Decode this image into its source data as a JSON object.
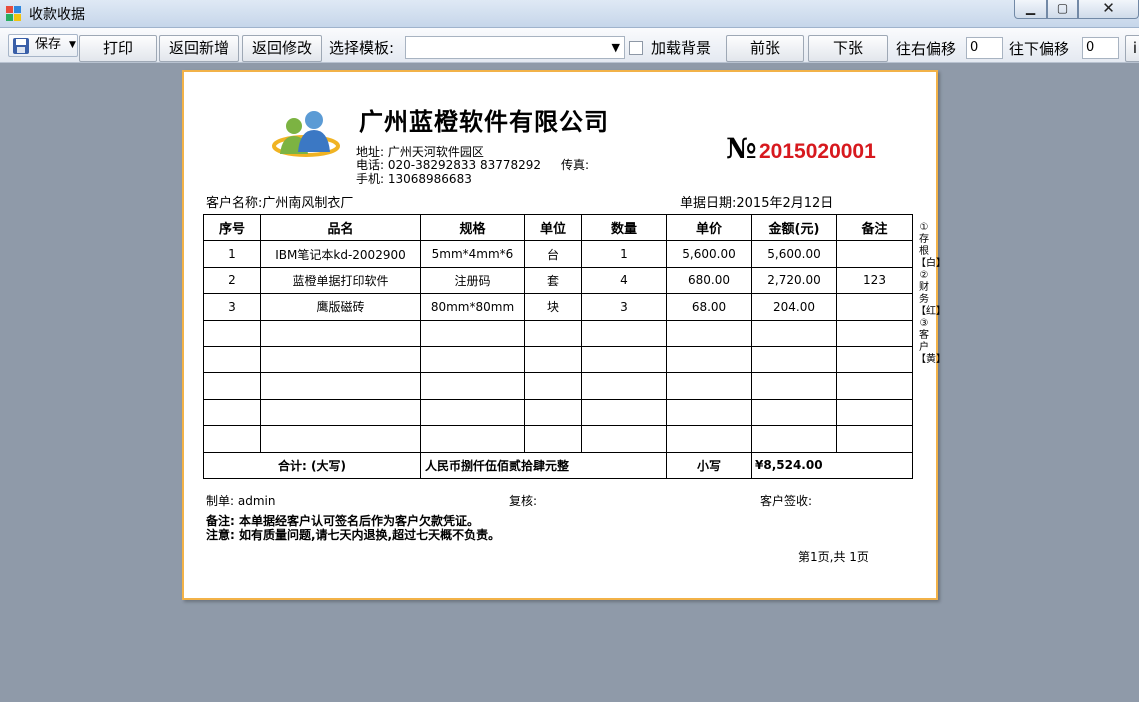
{
  "window": {
    "title": "收款收据"
  },
  "toolbar": {
    "save_label": "保存",
    "print_label": "打印",
    "back_new_label": "返回新增",
    "back_edit_label": "返回修改",
    "template_label": "选择模板:",
    "template_value": "",
    "load_bg_label": "加载背景",
    "prev_label": "前张",
    "next_label": "下张",
    "offset_right_label": "往右偏移",
    "offset_right_value": "0",
    "offset_down_label": "往下偏移",
    "offset_down_value": "0",
    "cut_label": "i"
  },
  "receipt": {
    "company": "广州蓝橙软件有限公司",
    "address": "地址: 广州天河软件园区",
    "phone": "电话: 020-38292833 83778292",
    "fax": "传真:",
    "mobile": "手机: 13068986683",
    "no_mark": "№",
    "number": "2015020001",
    "customer": "客户名称:广州南风制衣厂",
    "date": "单据日期:2015年2月12日",
    "headers": [
      "序号",
      "品名",
      "规格",
      "单位",
      "数量",
      "单价",
      "金额(元)",
      "备注"
    ],
    "rows": [
      [
        "1",
        "IBM笔记本kd-2002900",
        "5mm*4mm*6",
        "台",
        "1",
        "5,600.00",
        "5,600.00",
        ""
      ],
      [
        "2",
        "蓝橙单据打印软件",
        "注册码",
        "套",
        "4",
        "680.00",
        "2,720.00",
        "123"
      ],
      [
        "3",
        "鹰版磁砖",
        "80mm*80mm",
        "块",
        "3",
        "68.00",
        "204.00",
        ""
      ],
      [
        "",
        "",
        "",
        "",
        "",
        "",
        "",
        ""
      ],
      [
        "",
        "",
        "",
        "",
        "",
        "",
        "",
        ""
      ],
      [
        "",
        "",
        "",
        "",
        "",
        "",
        "",
        ""
      ],
      [
        "",
        "",
        "",
        "",
        "",
        "",
        "",
        ""
      ],
      [
        "",
        "",
        "",
        "",
        "",
        "",
        "",
        ""
      ]
    ],
    "total_label": "合计: (大写)",
    "total_upper": "人民币捌仟伍佰贰拾肆元整",
    "small_label": "小写",
    "total_lower": "¥8,524.00",
    "side_copies": "①存根【白】②财务【红】③客户【黄】",
    "maker": "制单: admin",
    "reviewer": "复核:",
    "signer": "客户签收:",
    "note1": "备注: 本单据经客户认可签名后作为客户欠款凭证。",
    "note2": "注意: 如有质量问题,请七天内退换,超过七天概不负责。",
    "page": "第1页,共 1页"
  },
  "colors": {
    "accent_red": "#d7191e",
    "paper_border": "#f2b248",
    "desktop": "#8f9aa9"
  }
}
